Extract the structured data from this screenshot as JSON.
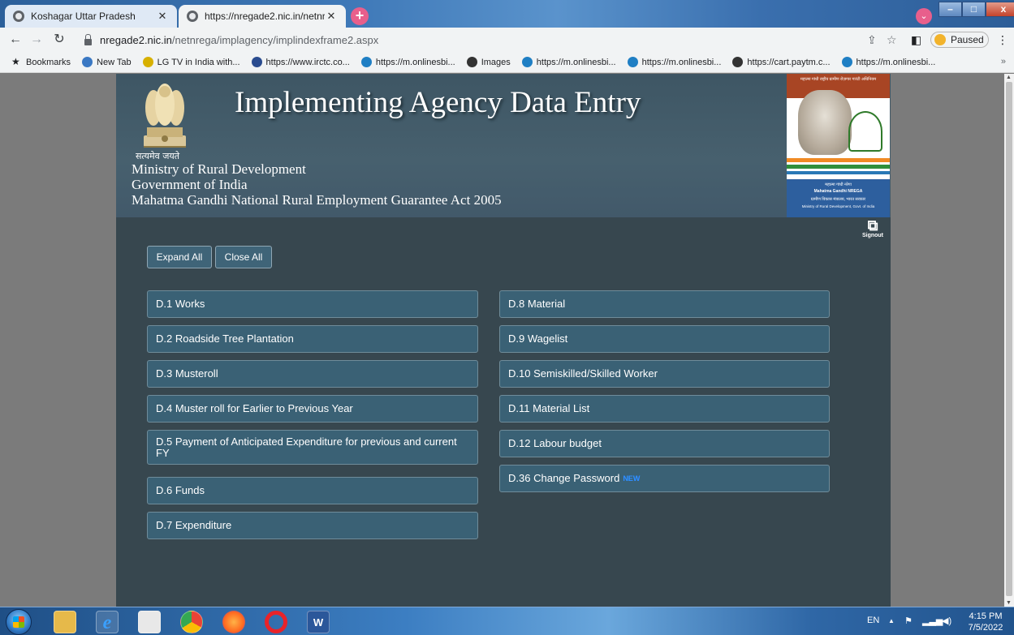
{
  "browser": {
    "tabs": [
      {
        "title": "Koshagar Uttar Pradesh",
        "close": "✕"
      },
      {
        "title": "https://nregade2.nic.in/netnrega",
        "close": "✕"
      }
    ],
    "new_tab": "+",
    "tab_search": "⌄",
    "window_buttons": {
      "minimize": "–",
      "maximize": "□",
      "close": "x"
    },
    "url_host": "nregade2.nic.in",
    "url_path": "/netnrega/implagency/implindexframe2.aspx",
    "profile_status": "Paused",
    "menu": "⋮",
    "bookmarks": [
      {
        "label": "Bookmarks",
        "color": "#202124"
      },
      {
        "label": "New Tab",
        "color": "#3a78c3"
      },
      {
        "label": "LG TV in India with...",
        "color": "#d7b000"
      },
      {
        "label": "https://www.irctc.co...",
        "color": "#2a4c8f"
      },
      {
        "label": "https://m.onlinesbi...",
        "color": "#1f7fc4"
      },
      {
        "label": "Images",
        "color": "#333333"
      },
      {
        "label": "https://m.onlinesbi...",
        "color": "#1f7fc4"
      },
      {
        "label": "https://m.onlinesbi...",
        "color": "#1f7fc4"
      },
      {
        "label": "https://cart.paytm.c...",
        "color": "#333333"
      },
      {
        "label": "https://m.onlinesbi...",
        "color": "#1f7fc4"
      }
    ],
    "bookmarks_more": "»"
  },
  "page": {
    "title": "Implementing Agency Data Entry",
    "motto": "सत्यमेव जयते",
    "ministry_lines": [
      "Ministry of Rural Development",
      "Government of India",
      "Mahatma Gandhi National Rural Employment Guarantee Act 2005"
    ],
    "logo_top_text": "महात्मा गांधी राष्ट्रीय ग्रामीण रोज़गार गारंटी अधिनियम",
    "logo_mid_text": "महात्मा गांधी नरेगा",
    "logo_name_text": "Mahatma Gandhi NREGA",
    "logo_bottom_text": "ग्रामीण विकास मंत्रालय, भारत सरकार",
    "logo_bottom_text_en": "Ministry of Rural Development, Govt. of India",
    "signout_label": "Signout",
    "expand_all": "Expand All",
    "close_all": "Close All",
    "left_items": [
      "D.1 Works",
      "D.2 Roadside Tree Plantation",
      "D.3 Musteroll",
      "D.4 Muster roll for Earlier to Previous Year",
      "D.5 Payment of Anticipated Expenditure for previous and current FY",
      "D.6 Funds",
      "D.7 Expenditure"
    ],
    "right_items": [
      "D.8 Material",
      "D.9 Wagelist",
      "D.10 Semiskilled/Skilled Worker",
      "D.11 Material List",
      "D.12 Labour budget",
      "D.36 Change Password"
    ],
    "new_badge": "NEW"
  },
  "taskbar": {
    "language": "EN",
    "tray_up": "▲",
    "time": "4:15 PM",
    "date": "7/5/2022"
  }
}
